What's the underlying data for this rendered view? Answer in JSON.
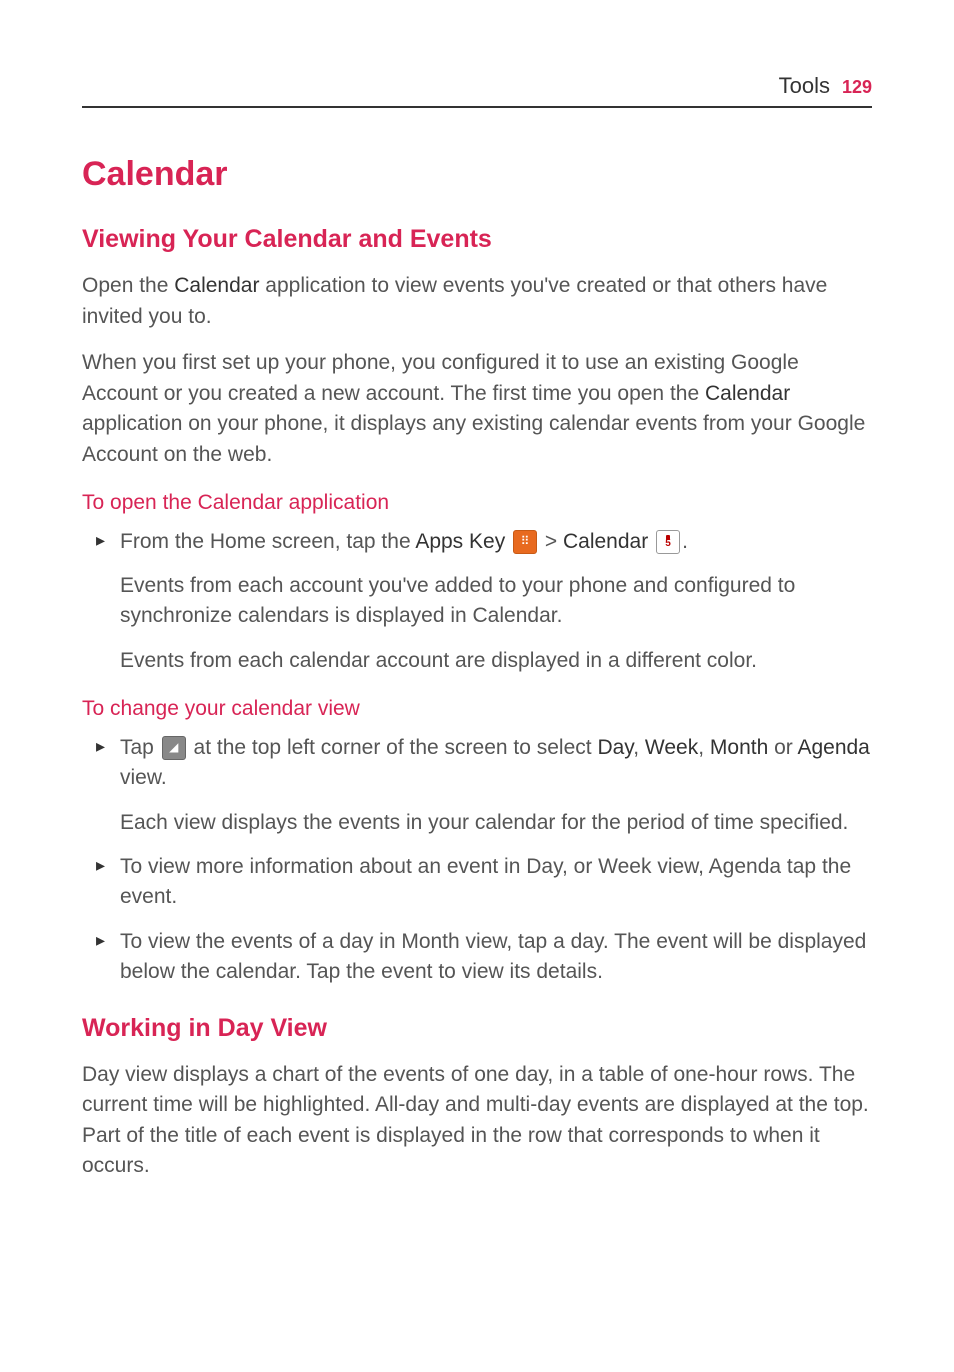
{
  "header": {
    "section": "Tools",
    "page": "129"
  },
  "title": "Calendar",
  "h2_view": "Viewing Your Calendar and Events",
  "p1_a": "Open the ",
  "p1_b": "Calendar",
  "p1_c": " application to view events you've created or that others have invited you to.",
  "p2_a": "When you first set up your phone, you configured it to use an existing Google Account or you created a new account. The first time you open the ",
  "p2_b": "Calendar",
  "p2_c": " application on your phone, it displays any existing calendar events from your Google Account on the web.",
  "h3_open": "To open the Calendar application",
  "open": {
    "step1_a": "From the Home screen, tap the ",
    "step1_b": "Apps Key",
    "step1_c": " > ",
    "step1_d": "Calendar",
    "step1_e": ".",
    "sub1": "Events from each account you've added to your phone and configured to synchronize calendars is displayed in Calendar.",
    "sub2": "Events from each calendar account are displayed in a different color."
  },
  "h3_change": "To change your calendar view",
  "change": {
    "step1_a": "Tap ",
    "step1_b": " at the top left corner of the screen to select ",
    "step1_c": "Day",
    "step1_d": ", ",
    "step1_e": "Week",
    "step1_f": ", ",
    "step1_g": "Month",
    "step1_h": " or ",
    "step1_i": "Agenda",
    "step1_j": " view.",
    "sub1": "Each view displays the events in your calendar for the period of time specified.",
    "step2": "To view more information about an event in Day, or Week view, Agenda tap the event.",
    "step3": "To view the events of a day in Month view, tap a day. The event will be displayed below the calendar. Tap the event to view its details."
  },
  "h2_day": "Working in Day View",
  "day_p": "Day view displays a chart of the events of one day, in a table of one-hour rows. The current time will be highlighted. All-day and multi-day events are displayed at the top. Part of the title of each event is displayed in the row that corresponds to when it occurs.",
  "icons": {
    "apps": "⠿",
    "drop": "◢",
    "cal": "5"
  }
}
